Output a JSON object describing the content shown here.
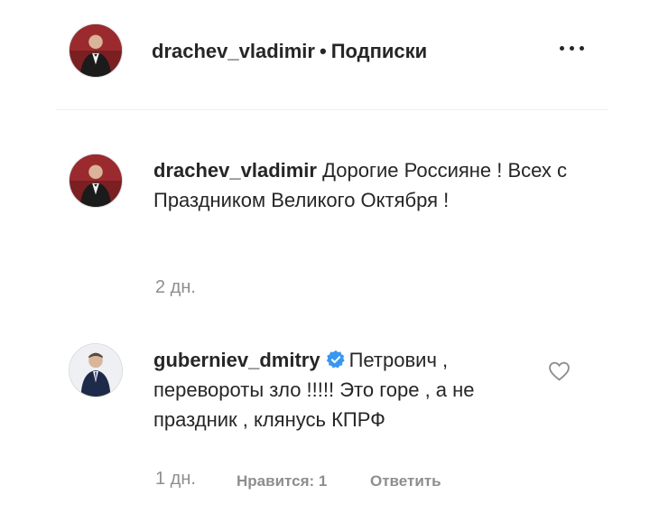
{
  "header": {
    "username": "drachev_vladimir",
    "separator": "•",
    "follow_label": "Подписки"
  },
  "comments": [
    {
      "username": "drachev_vladimir",
      "text": "Дорогие Россияне ! Всех с Праздником Великого Октября !",
      "time": "2 дн."
    },
    {
      "username": "guberniev_dmitry",
      "verified": true,
      "text": "Петрович , перевороты зло !!!!! Это горе , а не праздник , клянусь КПРФ",
      "time": "1 дн.",
      "likes_label": "Нравится: 1",
      "reply_label": "Ответить"
    }
  ],
  "colors": {
    "text": "#262626",
    "secondary": "#8e8e8e",
    "verified": "#3897f0",
    "divider": "#efefef"
  }
}
